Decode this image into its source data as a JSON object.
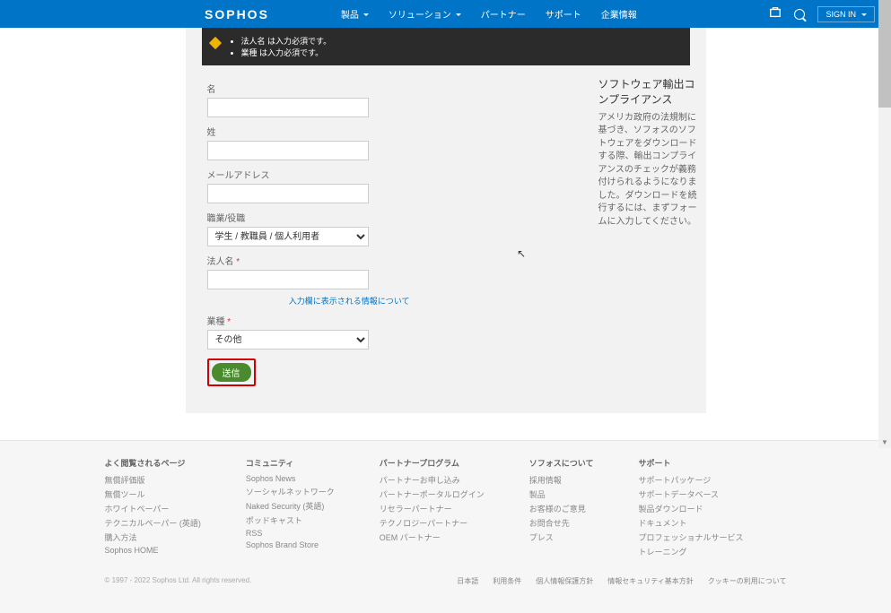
{
  "brand": "SOPHOS",
  "nav": {
    "products": "製品",
    "solutions": "ソリューション",
    "partners": "パートナー",
    "support": "サポート",
    "company": "企業情報",
    "signin": "SIGN IN"
  },
  "errors": {
    "e1": "法人名 は入力必須です。",
    "e2": "業種 は入力必須です。"
  },
  "form": {
    "fn_label": "名",
    "fn_ph": "  ",
    "ln_label": "姓",
    "ln_ph": "  ",
    "email_label": "メールアドレス",
    "email_ph": "  ",
    "role_label": "職業/役職",
    "role_value": "学生 / 教職員 / 個人利用者",
    "company_label": "法人名",
    "company_ph": "  ",
    "industry_label": "業種",
    "industry_value": "その他",
    "infolink": "入力欄に表示される情報について",
    "submit": "送信"
  },
  "side": {
    "title": "ソフトウェア輸出コンプライアンス",
    "body": "アメリカ政府の法規制に基づき、ソフォスのソフトウェアをダウンロードする際、輸出コンプライアンスのチェックが義務付けられるようになりました。ダウンロードを続行するには、まずフォームに入力してください。"
  },
  "footer": {
    "c1": {
      "h": "よく閲覧されるページ",
      "i": [
        "無償評価版",
        "無償ツール",
        "ホワイトペーパー",
        "テクニカルペーパー (英語)",
        "購入方法",
        "Sophos HOME"
      ]
    },
    "c2": {
      "h": "コミュニティ",
      "i": [
        "Sophos News",
        "ソーシャルネットワーク",
        "Naked Security (英語)",
        "ポッドキャスト",
        "RSS",
        "Sophos Brand Store"
      ]
    },
    "c3": {
      "h": "パートナープログラム",
      "i": [
        "パートナーお申し込み",
        "パートナーポータルログイン",
        "リセラーパートナー",
        "テクノロジーパートナー",
        "OEM パートナー"
      ]
    },
    "c4": {
      "h": "ソフォスについて",
      "i": [
        "採用情報",
        "製品",
        "お客様のご意見",
        "お問合せ先",
        "プレス"
      ]
    },
    "c5": {
      "h": "サポート",
      "i": [
        "サポートパッケージ",
        "サポートデータベース",
        "製品ダウンロード",
        "ドキュメント",
        "プロフェッショナルサービス",
        "トレーニング"
      ]
    },
    "copy": "© 1997 - 2022 Sophos Ltd. All rights reserved.",
    "legal": [
      "日本語",
      "利用条件",
      "個人情報保護方針",
      "情報セキュリティ基本方針",
      "クッキーの利用について"
    ]
  }
}
